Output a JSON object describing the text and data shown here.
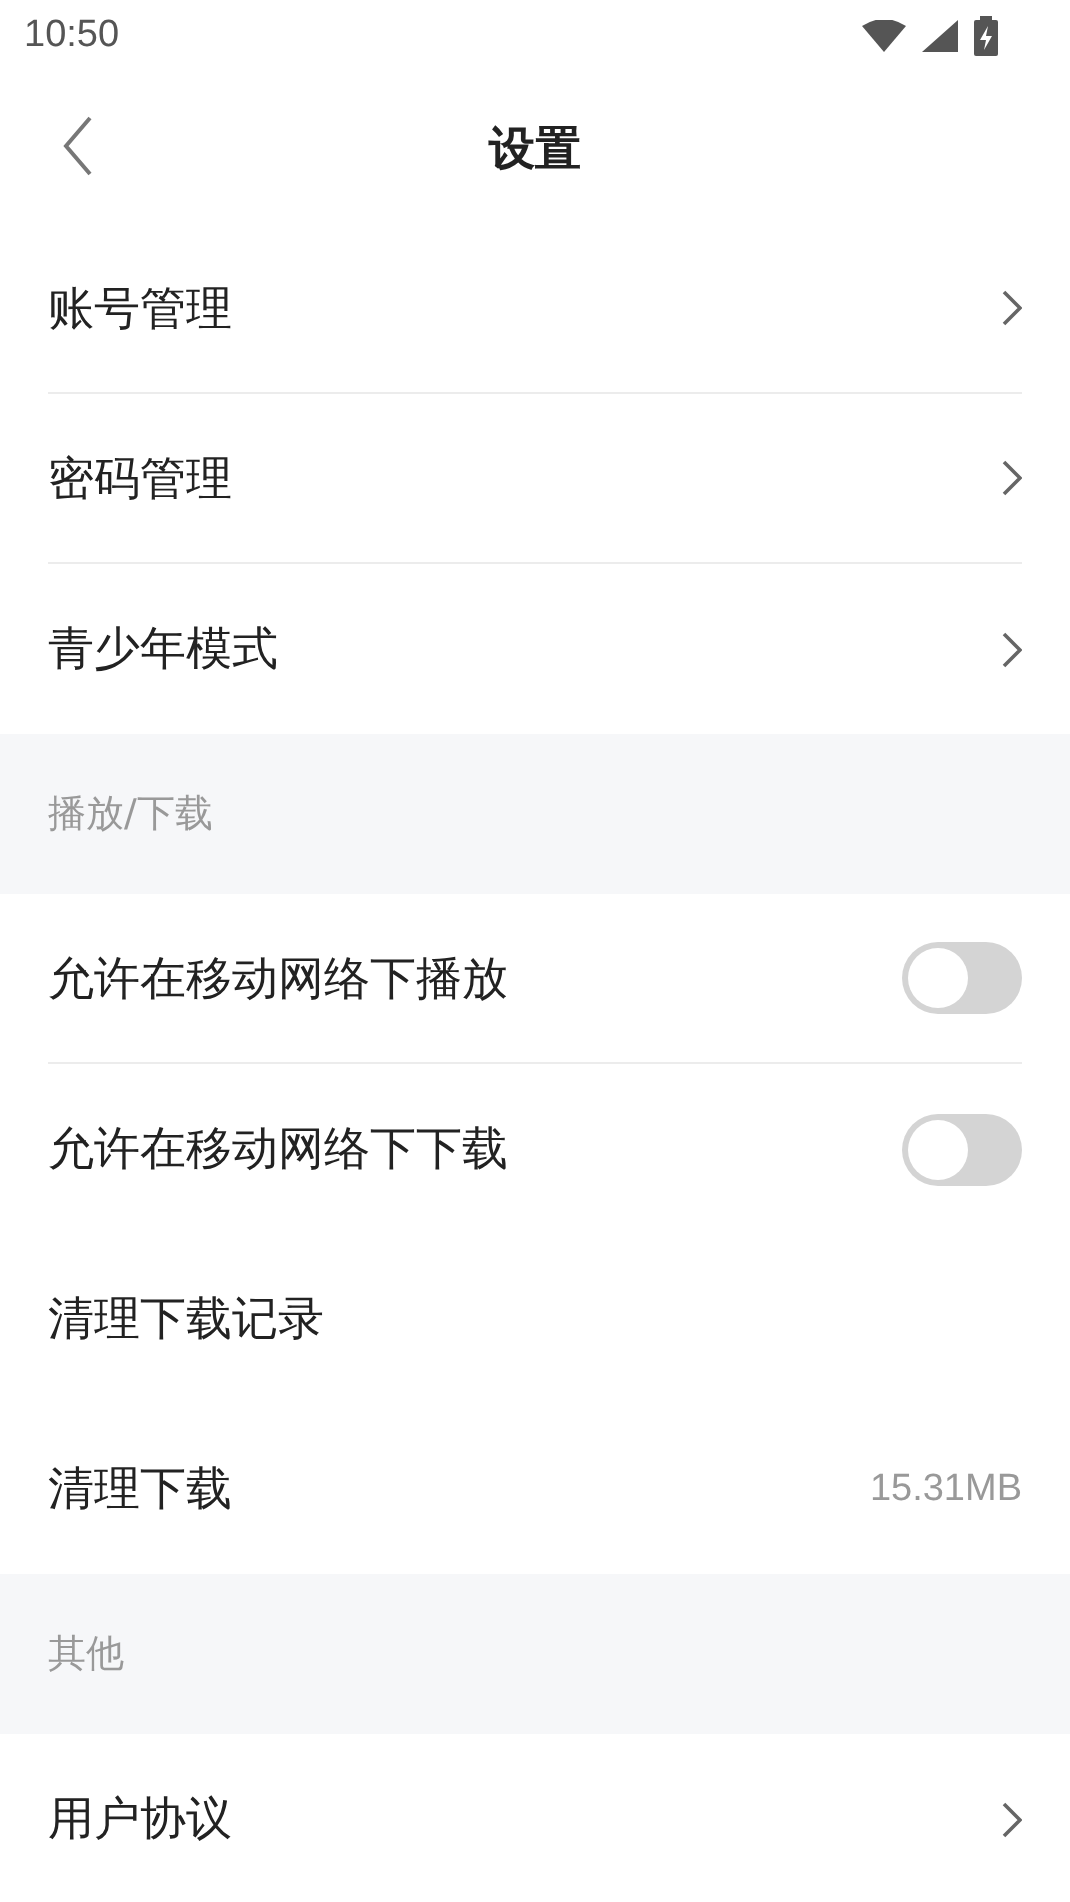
{
  "status_bar": {
    "time": "10:50"
  },
  "nav": {
    "title": "设置"
  },
  "sections": [
    {
      "items": [
        {
          "kind": "link",
          "label": "账号管理",
          "divider": true
        },
        {
          "kind": "link",
          "label": "密码管理",
          "divider": true
        },
        {
          "kind": "link",
          "label": "青少年模式",
          "divider": false
        }
      ]
    },
    {
      "header": "播放/下载",
      "items": [
        {
          "kind": "toggle",
          "label": "允许在移动网络下播放",
          "on": false,
          "divider": true
        },
        {
          "kind": "toggle",
          "label": "允许在移动网络下下载",
          "on": false,
          "divider": false
        },
        {
          "kind": "plain",
          "label": "清理下载记录",
          "divider": false
        },
        {
          "kind": "value",
          "label": "清理下载",
          "value": "15.31MB",
          "divider": false
        }
      ]
    },
    {
      "header": "其他",
      "items": [
        {
          "kind": "link",
          "label": "用户协议",
          "divider": false
        }
      ]
    }
  ]
}
